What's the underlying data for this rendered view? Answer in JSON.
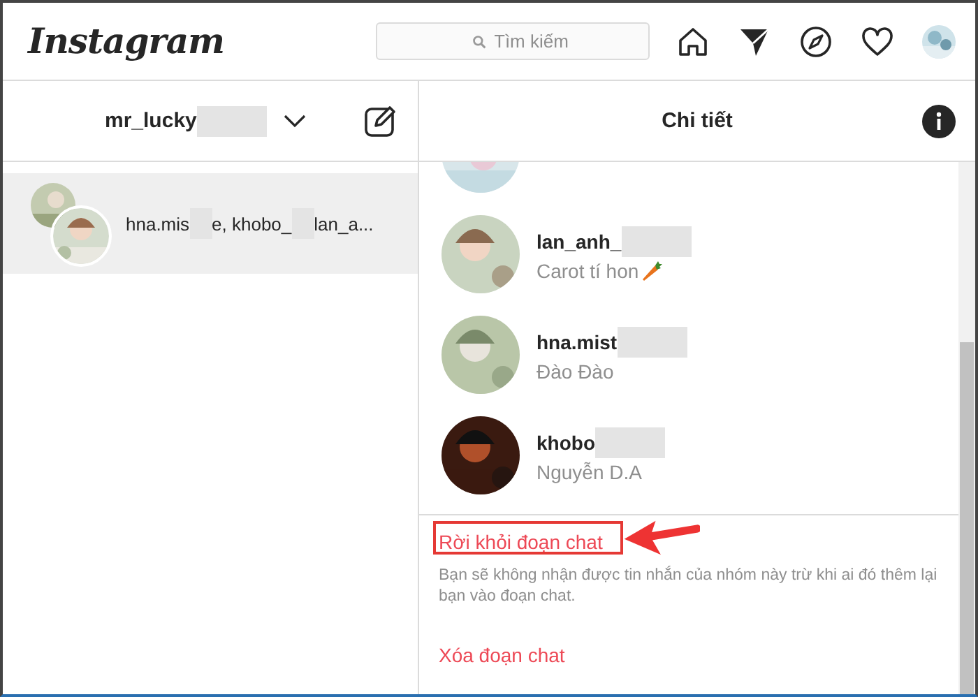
{
  "header": {
    "logo": "Instagram",
    "search": {
      "placeholder": "Tìm kiếm"
    }
  },
  "sidebar": {
    "username": "mr_lucky",
    "conversations": [
      {
        "title_parts": [
          "hna.mis",
          "e, khobo_",
          "lan_a..."
        ],
        "selected": true
      }
    ]
  },
  "details": {
    "title": "Chi tiết",
    "members": [
      {
        "name": "lan_anh_",
        "subtitle": "Carot tí hon",
        "emoji": true
      },
      {
        "name": "hna.mist",
        "subtitle": "Đào Đào",
        "emoji": false
      },
      {
        "name": "khobo",
        "subtitle": "Nguyễn D.A",
        "emoji": false
      }
    ],
    "actions": [
      {
        "label": "Rời khỏi đoạn chat",
        "highlighted": true,
        "note": "Bạn sẽ không nhận được tin nhắn của nhóm này trừ khi ai đó thêm lại bạn vào đoạn chat."
      },
      {
        "label": "Xóa đoạn chat",
        "highlighted": false
      }
    ]
  }
}
